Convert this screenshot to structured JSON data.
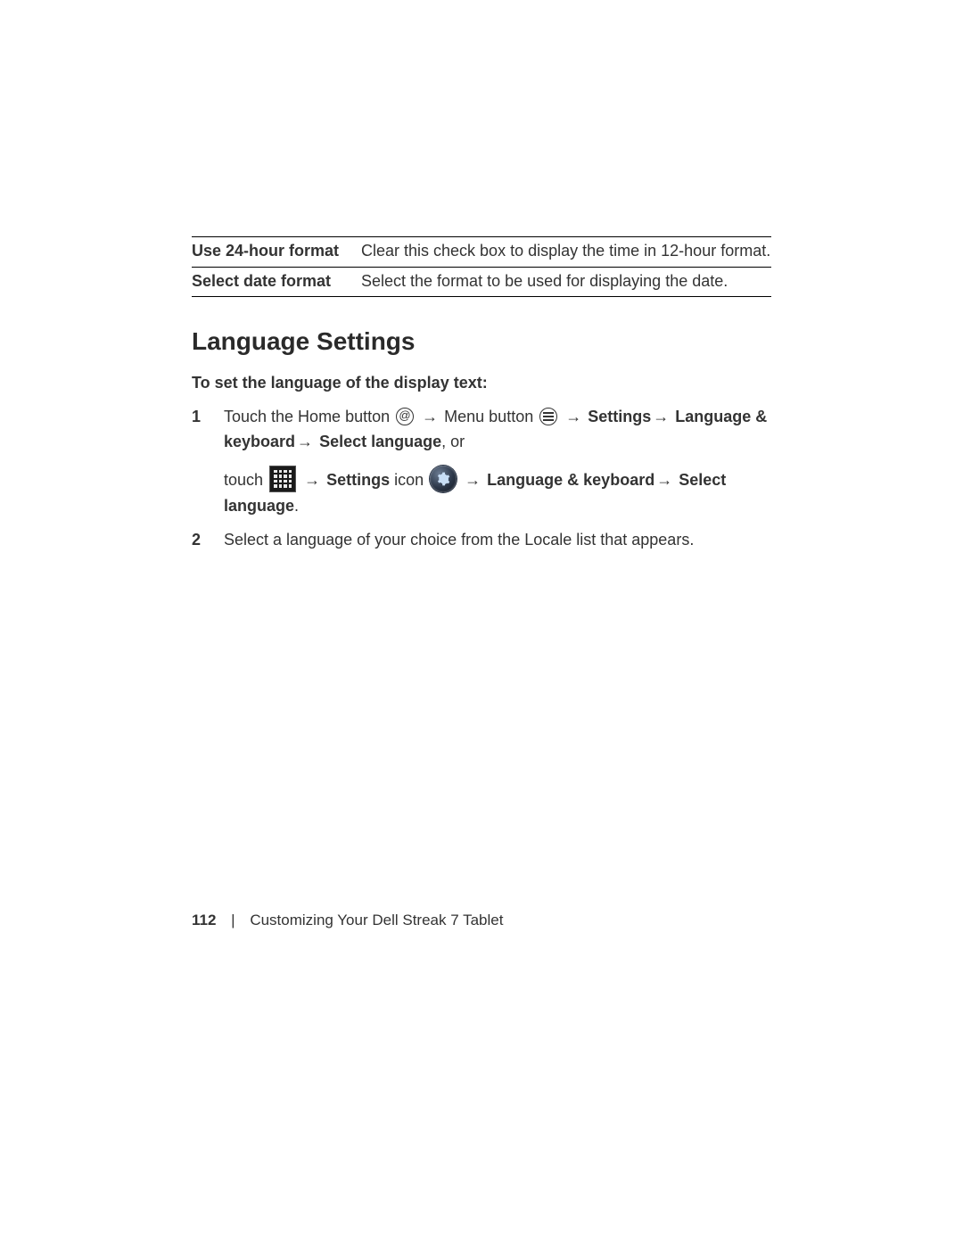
{
  "table": {
    "row1": {
      "label": "Use 24-hour format",
      "desc": "Clear this check box to display the time in 12-hour format."
    },
    "row2": {
      "label": "Select date format",
      "desc": "Select the format to be used for displaying the date."
    }
  },
  "heading": "Language Settings",
  "subheading": "To set the language of the display text:",
  "step1": {
    "num": "1",
    "part_touch_home": "Touch the Home button ",
    "arrow": "→",
    "part_menu": " Menu button ",
    "settings_bold": "Settings",
    "lang_keyboard_bold": "Language & keyboard",
    "select_lang_bold": "Select language",
    "or_text": ", or",
    "touch_text": "touch ",
    "settings_icon_label_bold": "Settings",
    "icon_word": " icon "
  },
  "step2": {
    "num": "2",
    "text": "Select a language of your choice from the Locale list that appears."
  },
  "footer": {
    "page_num": "112",
    "divider": "|",
    "chapter": "Customizing Your Dell Streak 7 Tablet"
  }
}
